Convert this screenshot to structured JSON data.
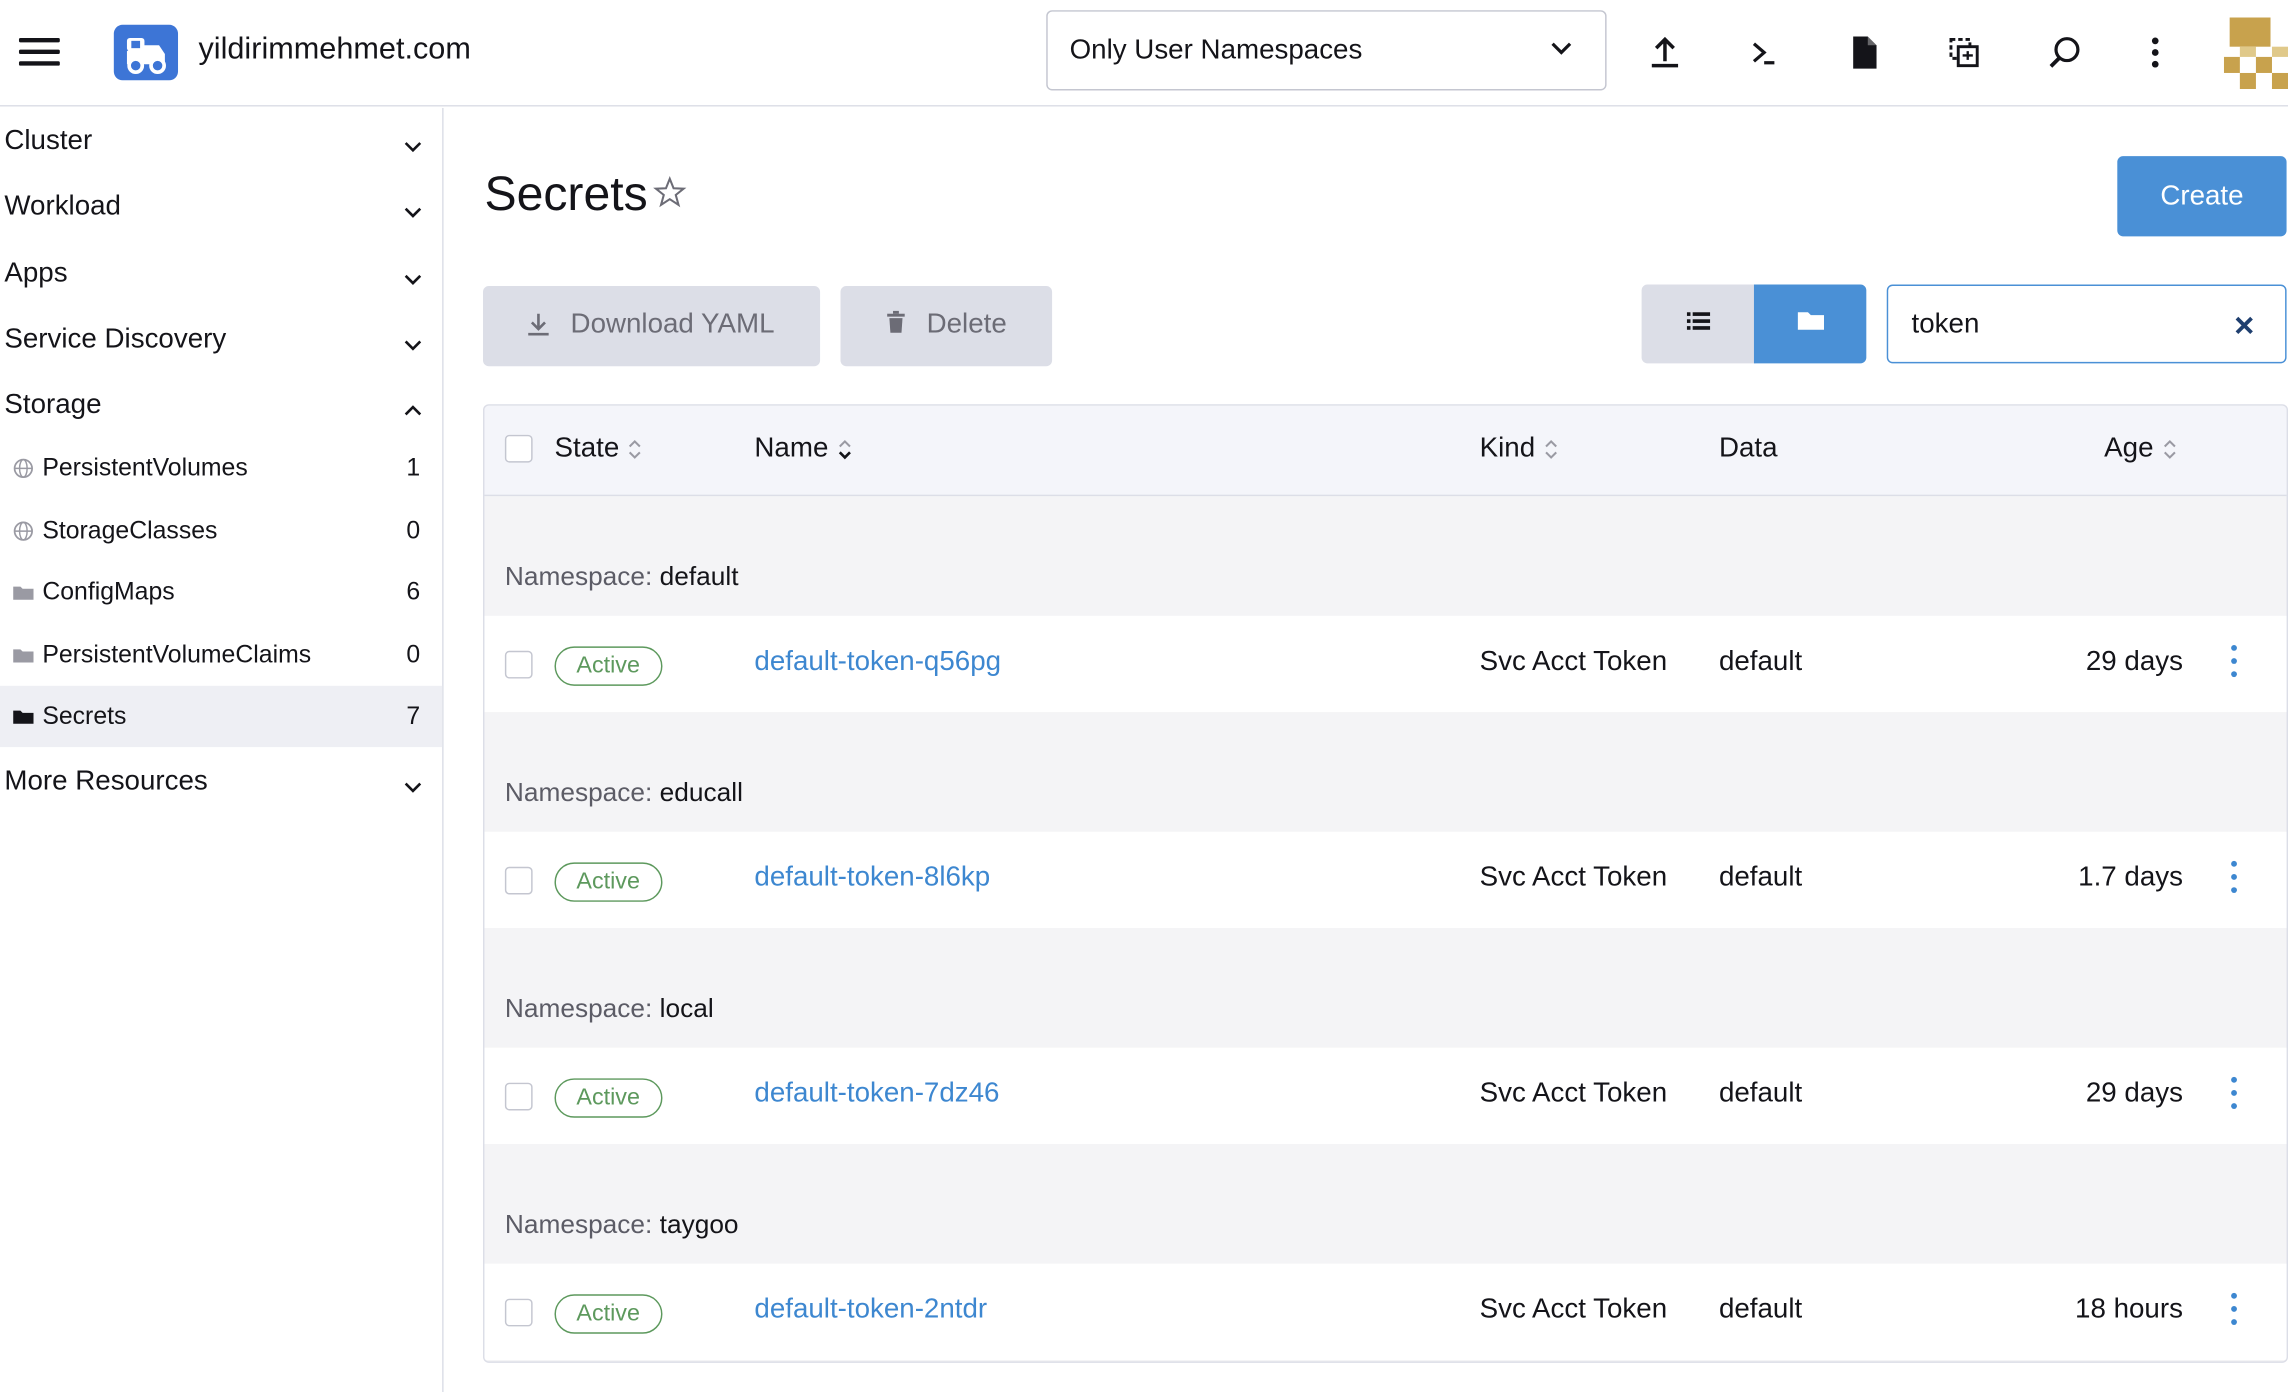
{
  "header": {
    "cluster_name": "yildirimmehmet.com",
    "namespace_filter": "Only User Namespaces",
    "icons": [
      "menu-icon",
      "cluster-logo-icon",
      "chevron-down-icon",
      "upload-icon",
      "terminal-icon",
      "file-icon",
      "copy-icon",
      "search-icon",
      "more-vertical-icon",
      "avatar"
    ]
  },
  "sidebar": {
    "groups": [
      {
        "label": "Cluster",
        "expanded": false
      },
      {
        "label": "Workload",
        "expanded": false
      },
      {
        "label": "Apps",
        "expanded": false
      },
      {
        "label": "Service Discovery",
        "expanded": false
      },
      {
        "label": "Storage",
        "expanded": true
      },
      {
        "label": "More Resources",
        "expanded": false
      }
    ],
    "storage_items": [
      {
        "label": "PersistentVolumes",
        "count": "1",
        "icon": "globe-icon"
      },
      {
        "label": "StorageClasses",
        "count": "0",
        "icon": "globe-icon"
      },
      {
        "label": "ConfigMaps",
        "count": "6",
        "icon": "folder-icon"
      },
      {
        "label": "PersistentVolumeClaims",
        "count": "0",
        "icon": "folder-icon"
      },
      {
        "label": "Secrets",
        "count": "7",
        "icon": "folder-icon",
        "active": true
      }
    ]
  },
  "main": {
    "title": "Secrets",
    "create_label": "Create",
    "download_label": "Download YAML",
    "delete_label": "Delete",
    "search_value": "token",
    "view_mode": "group-by-namespace"
  },
  "table": {
    "columns": [
      "State",
      "Name",
      "Kind",
      "Data",
      "Age"
    ],
    "namespace_key": "Namespace:",
    "groups": [
      {
        "namespace": "default",
        "state": "Active",
        "name": "default-token-q56pg",
        "kind": "Svc Acct Token",
        "data": "default",
        "age": "29 days"
      },
      {
        "namespace": "educall",
        "state": "Active",
        "name": "default-token-8l6kp",
        "kind": "Svc Acct Token",
        "data": "default",
        "age": "1.7 days"
      },
      {
        "namespace": "local",
        "state": "Active",
        "name": "default-token-7dz46",
        "kind": "Svc Acct Token",
        "data": "default",
        "age": "29 days"
      },
      {
        "namespace": "taygoo",
        "state": "Active",
        "name": "default-token-2ntdr",
        "kind": "Svc Acct Token",
        "data": "default",
        "age": "18 hours"
      }
    ]
  },
  "colors": {
    "accent": "#4a90d6",
    "link": "#3d87d0",
    "active_badge": "#5d995d",
    "sidebar_active_bg": "#eeeff4"
  }
}
